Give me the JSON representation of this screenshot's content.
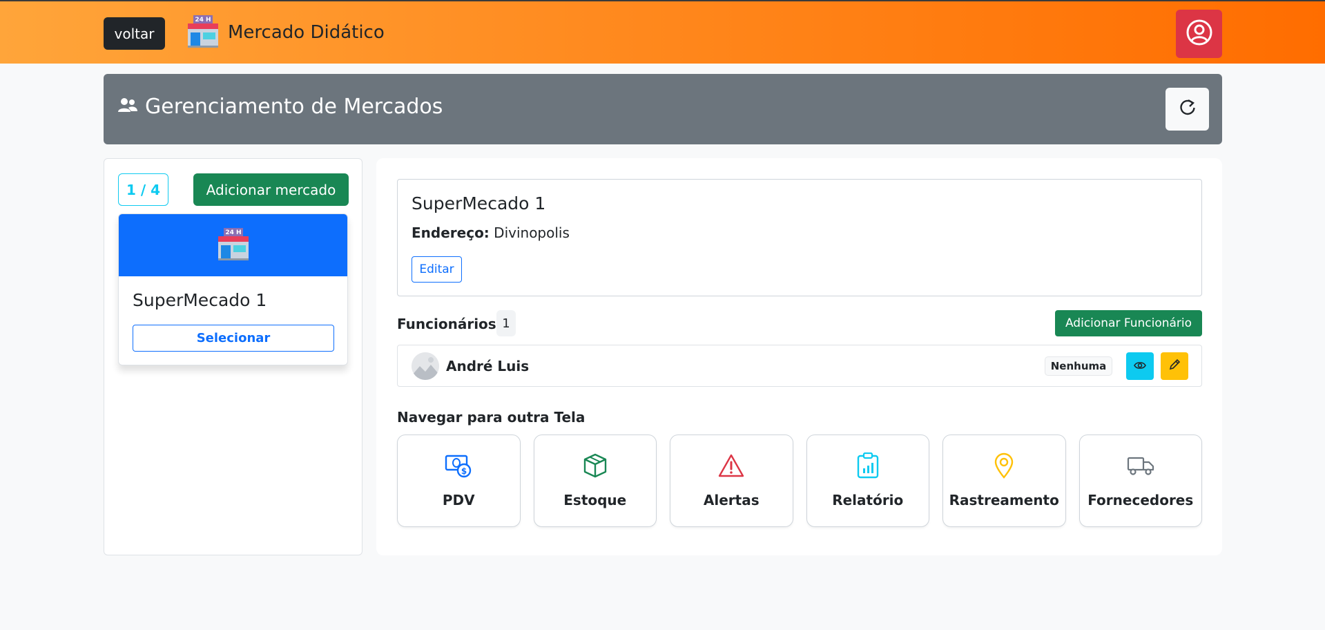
{
  "header": {
    "back_label": "voltar",
    "brand_title": "Mercado Didático",
    "brand_icon": "store-icon",
    "profile_icon": "user-circle-icon"
  },
  "page": {
    "title": "Gerenciamento de Mercados",
    "title_icon": "users-icon",
    "refresh_icon": "refresh-icon"
  },
  "markets_panel": {
    "counter": "1 / 4",
    "add_label": "Adicionar mercado",
    "cards": [
      {
        "name": "SuperMecado 1",
        "select_label": "Selecionar",
        "icon": "store-icon"
      }
    ]
  },
  "market_detail": {
    "name": "SuperMecado 1",
    "address_label": "Endereço:",
    "address_value": "Divinopolis",
    "edit_label": "Editar"
  },
  "employees": {
    "title": "Funcionários",
    "count": "1",
    "add_label": "Adicionar Funcionário",
    "rows": [
      {
        "name": "André Luis",
        "role": "Nenhuma"
      }
    ]
  },
  "navigation": {
    "title": "Navegar para outra Tela",
    "items": [
      {
        "label": "PDV",
        "icon": "cash-icon",
        "color": "#0d6efd"
      },
      {
        "label": "Estoque",
        "icon": "box-icon",
        "color": "#198754"
      },
      {
        "label": "Alertas",
        "icon": "warning-icon",
        "color": "#dc3545"
      },
      {
        "label": "Relatório",
        "icon": "report-icon",
        "color": "#0dcaf0"
      },
      {
        "label": "Rastreamento",
        "icon": "location-pin-icon",
        "color": "#ffc107"
      },
      {
        "label": "Fornecedores",
        "icon": "truck-icon",
        "color": "#6c757d"
      }
    ]
  },
  "colors": {
    "header_start": "#ffa53a",
    "header_end": "#ff6d00",
    "success": "#198754",
    "primary": "#0d6efd",
    "danger": "#dc3545",
    "info": "#0dcaf0",
    "warning": "#ffc107",
    "secondary": "#6c757d"
  }
}
